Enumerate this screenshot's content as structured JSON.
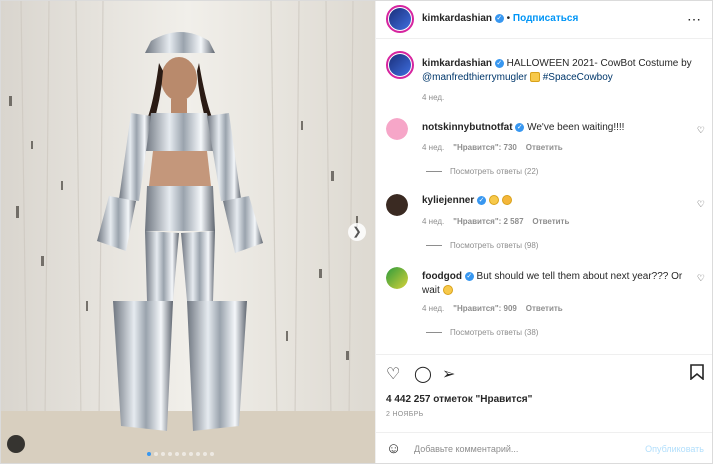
{
  "header": {
    "username": "kimkardashian",
    "separator": "•",
    "follow_label": "Подписаться",
    "more_icon": "⋯"
  },
  "caption": {
    "username": "kimkardashian",
    "text_main": "HALLOWEEN 2021- CowBot Costume by",
    "mention": "@manfredthierrymugler",
    "hashtag": "#SpaceCowboy",
    "time": "4 нед."
  },
  "comments": [
    {
      "username": "notskinnybutnotfat",
      "text": "We've been waiting!!!!",
      "time": "4 нед.",
      "likes": "\"Нравится\": 730",
      "reply": "Ответить",
      "view_replies": "Посмотреть ответы (22)"
    },
    {
      "username": "kyliejenner",
      "text": "",
      "time": "4 нед.",
      "likes": "\"Нравится\": 2 587",
      "reply": "Ответить",
      "view_replies": "Посмотреть ответы (98)"
    },
    {
      "username": "foodgod",
      "text": "But should we tell them about next year??? Or wait",
      "time": "4 нед.",
      "likes": "\"Нравится\": 909",
      "reply": "Ответить",
      "view_replies": "Посмотреть ответы (38)"
    }
  ],
  "stats": {
    "likes": "4 442 257 отметок \"Нравится\"",
    "date": "2 НОЯБРЬ"
  },
  "add_comment": {
    "placeholder": "Добавьте комментарий...",
    "publish": "Опубликовать"
  },
  "carousel": {
    "total": 10,
    "active_index": 0
  },
  "colors": {
    "accent": "#0095f6",
    "verified": "#3897f0",
    "ring": "#d6249f"
  }
}
